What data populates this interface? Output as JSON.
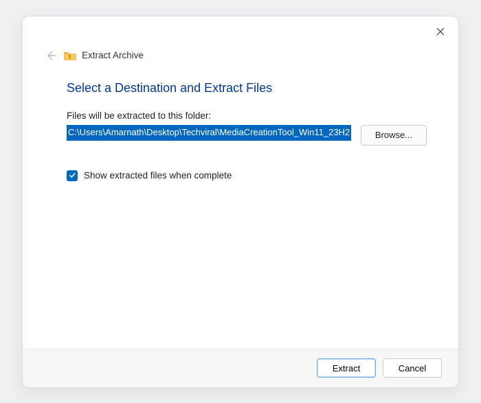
{
  "window_title": "Extract Archive",
  "heading": "Select a Destination and Extract Files",
  "path_label": "Files will be extracted to this folder:",
  "path_value": "C:\\Users\\Amarnath\\Desktop\\Techviral\\MediaCreationTool_Win11_23H2",
  "browse_label": "Browse...",
  "show_files_label": "Show extracted files when complete",
  "extract_label": "Extract",
  "cancel_label": "Cancel"
}
